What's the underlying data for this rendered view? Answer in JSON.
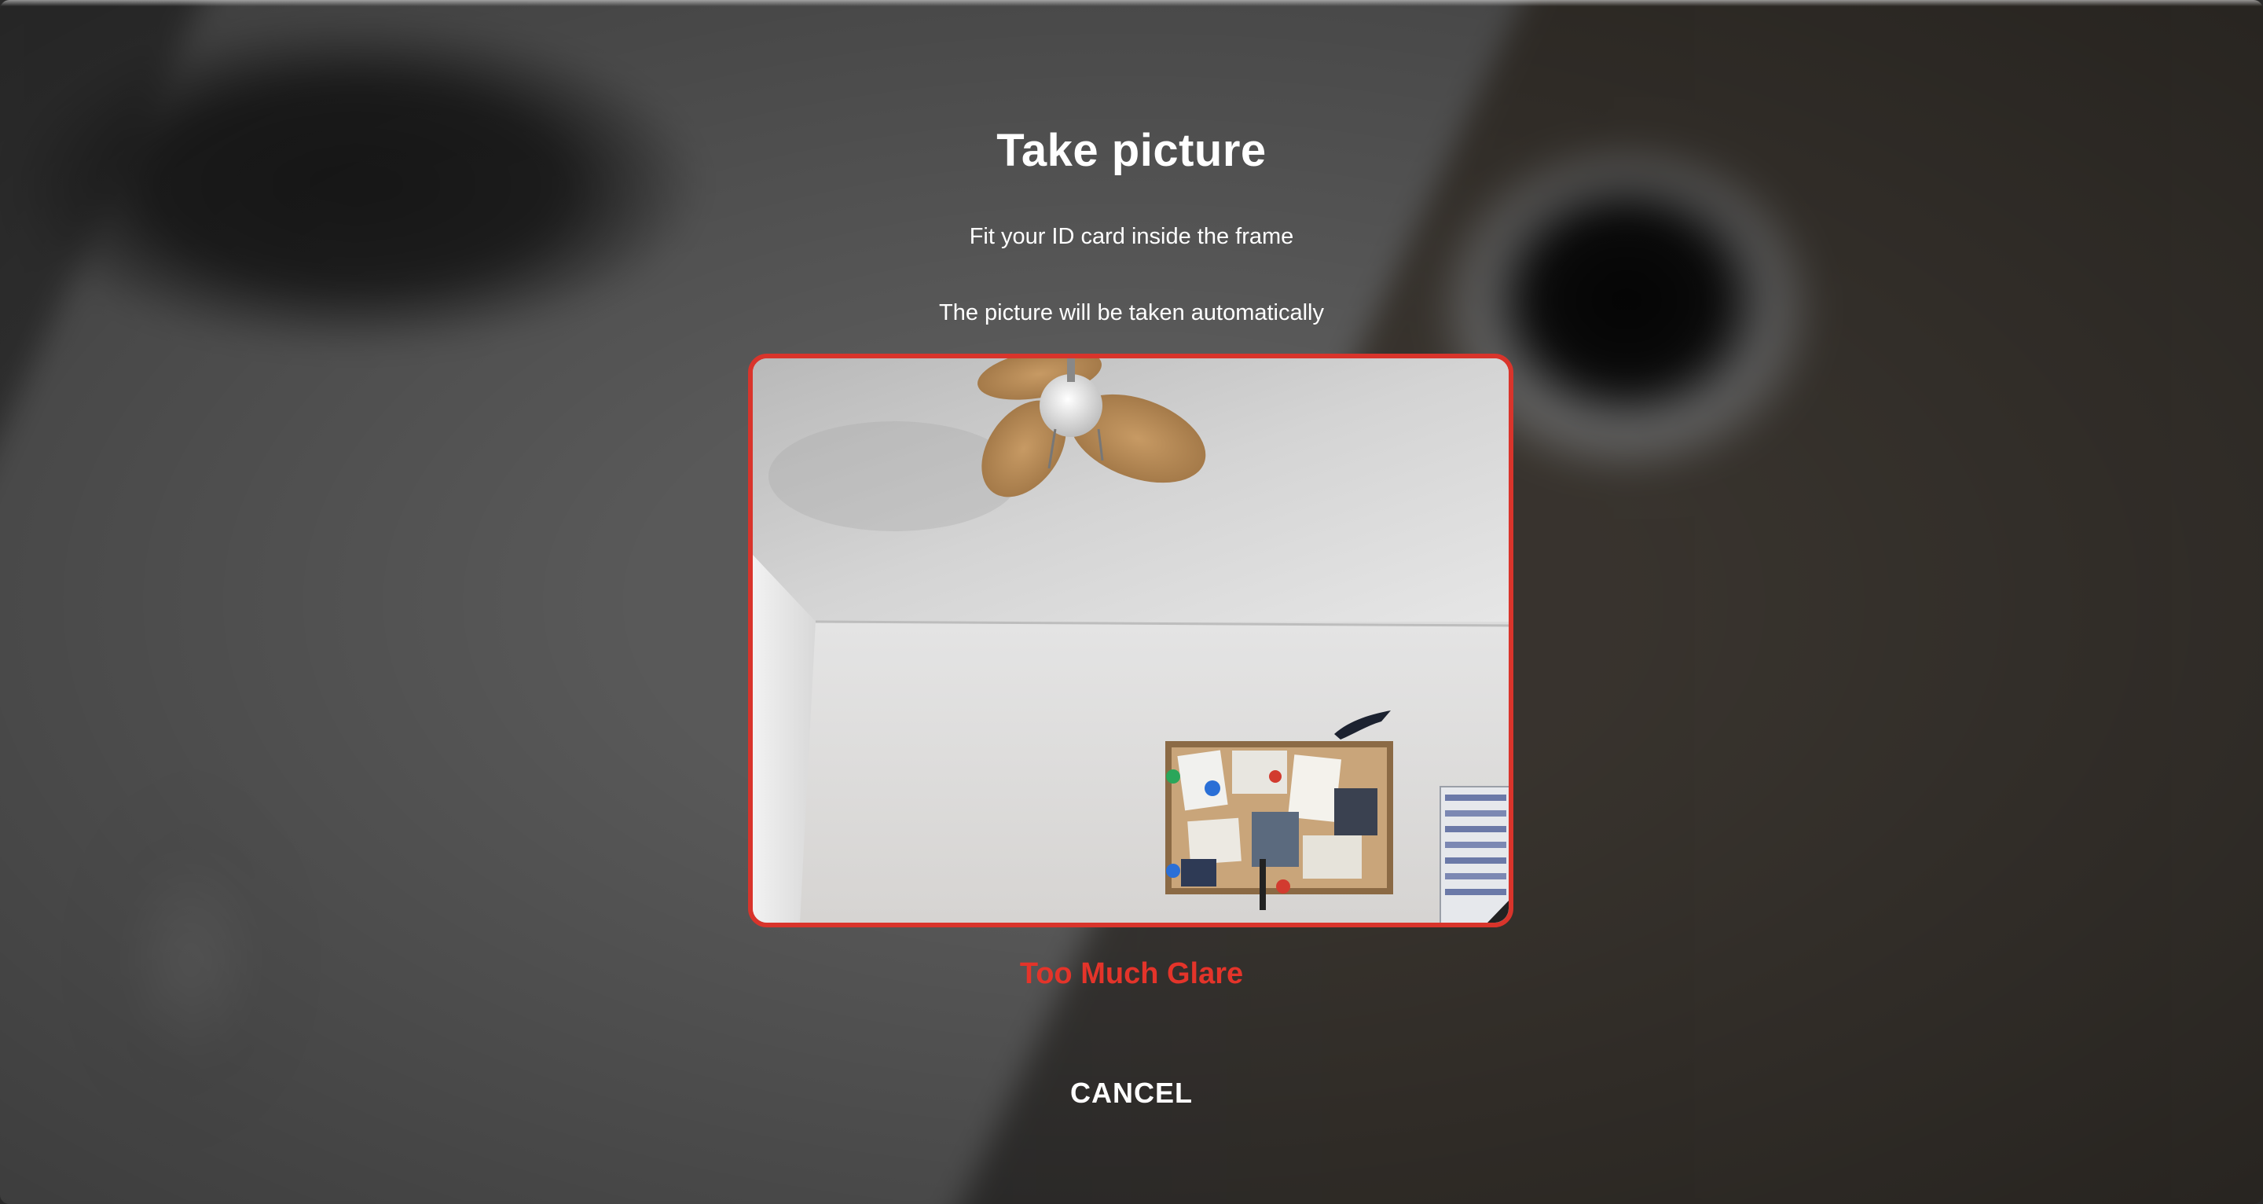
{
  "modal": {
    "title": "Take picture",
    "instruction_fit": "Fit your ID card inside the frame",
    "instruction_auto": "The picture will be taken automatically",
    "status_message": "Too Much Glare",
    "cancel_label": "CANCEL"
  },
  "colors": {
    "frame_border": "#d9342b",
    "status_text": "#e4342a",
    "text": "#ffffff"
  },
  "icons": {
    "camera_feed": "camera-preview-image"
  }
}
